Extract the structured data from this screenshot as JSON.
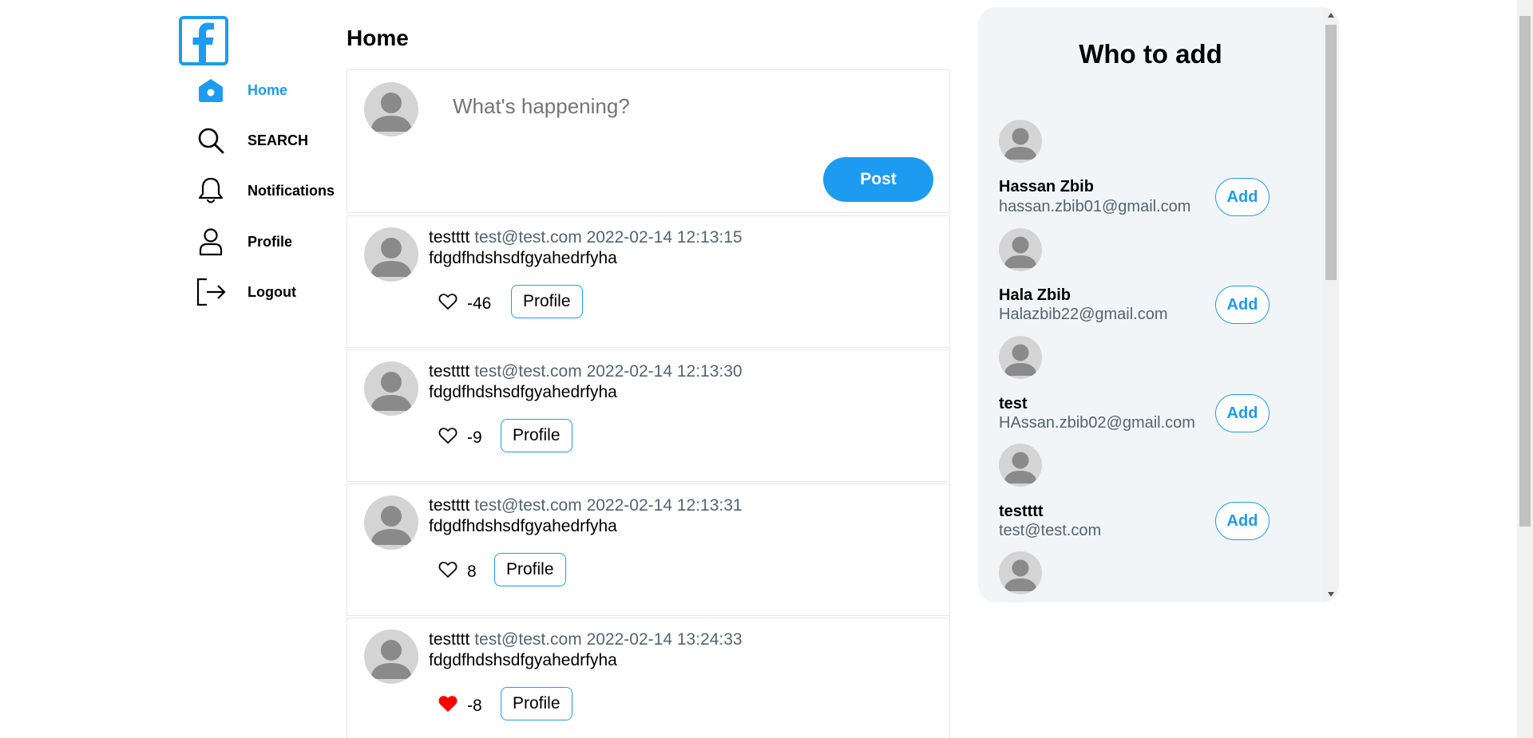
{
  "brand": {
    "name": "Facebook",
    "logo_icon": "facebook-logo-icon",
    "color": "#1d9bf0"
  },
  "sidebar": {
    "items": [
      {
        "label": "Home",
        "icon": "home-icon",
        "active": true
      },
      {
        "label": "SEARCH",
        "icon": "search-icon",
        "active": false
      },
      {
        "label": "Notifications",
        "icon": "bell-icon",
        "active": false
      },
      {
        "label": "Profile",
        "icon": "user-icon",
        "active": false
      },
      {
        "label": "Logout",
        "icon": "logout-icon",
        "active": false
      }
    ]
  },
  "main": {
    "title": "Home",
    "composer": {
      "placeholder": "What's happening?",
      "post_label": "Post"
    },
    "posts": [
      {
        "name": "testttt",
        "email": "test@test.com",
        "date": "2022-02-14 12:13:15",
        "text": "fdgdfhdshsdfgyahedrfyha",
        "likes": "-46",
        "liked": false,
        "profile_label": "Profile"
      },
      {
        "name": "testttt",
        "email": "test@test.com",
        "date": "2022-02-14 12:13:30",
        "text": "fdgdfhdshsdfgyahedrfyha",
        "likes": "-9",
        "liked": false,
        "profile_label": "Profile"
      },
      {
        "name": "testttt",
        "email": "test@test.com",
        "date": "2022-02-14 12:13:31",
        "text": "fdgdfhdshsdfgyahedrfyha",
        "likes": "8",
        "liked": false,
        "profile_label": "Profile"
      },
      {
        "name": "testttt",
        "email": "test@test.com",
        "date": "2022-02-14 13:24:33",
        "text": "fdgdfhdshsdfgyahedrfyha",
        "likes": "-8",
        "liked": true,
        "profile_label": "Profile"
      }
    ]
  },
  "who_to_add": {
    "title": "Who to add",
    "users": [
      {
        "name": "Hassan Zbib",
        "email": "hassan.zbib01@gmail.com",
        "add_label": "Add"
      },
      {
        "name": "Hala Zbib",
        "email": "Halazbib22@gmail.com",
        "add_label": "Add"
      },
      {
        "name": "test",
        "email": "HAssan.zbib02@gmail.com",
        "add_label": "Add"
      },
      {
        "name": "testttt",
        "email": "test@test.com",
        "add_label": "Add"
      }
    ]
  },
  "colors": {
    "accent": "#1d9bf0",
    "liked": "#ff0000",
    "muted": "#536471",
    "panel_bg": "#f2f5f7"
  }
}
